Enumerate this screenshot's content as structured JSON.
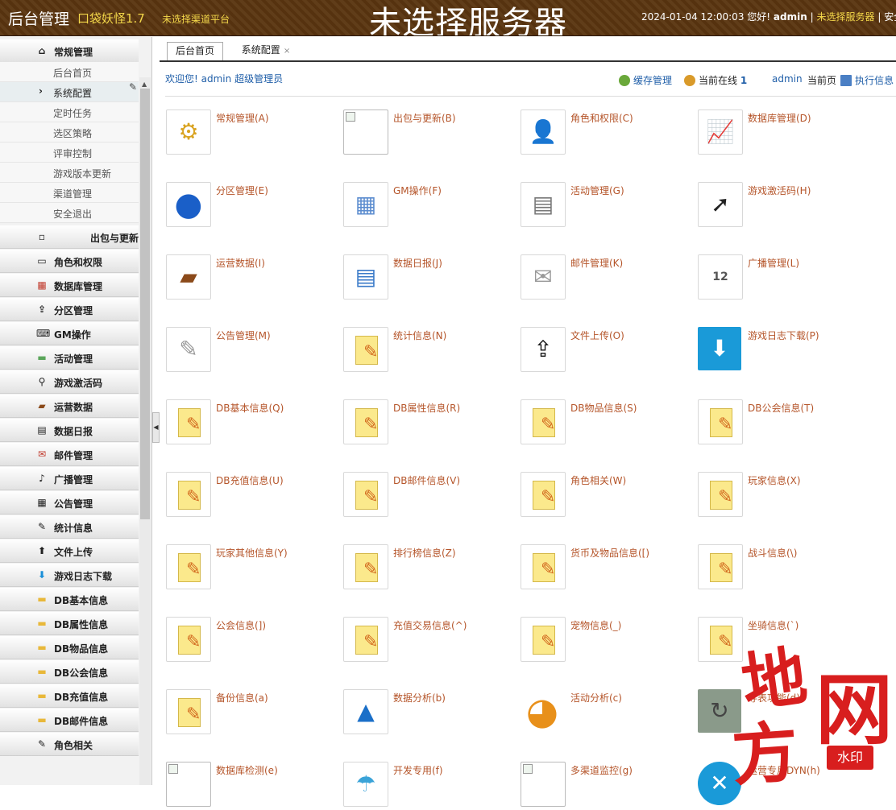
{
  "header": {
    "title": "后台管理",
    "game": "口袋妖怪1.7",
    "channel": "未选择渠道平台",
    "server_big": "未选择服务器",
    "datetime": "2024-01-04 12:00:03",
    "greeting": "您好!",
    "user": "admin",
    "sep1": "|",
    "server_link": "未选择服务器",
    "sep2": "|",
    "exit": "安全退"
  },
  "sidebar": {
    "sections": [
      {
        "label": "常规管理",
        "icon": "home-icon"
      },
      {
        "label": "出包与更新",
        "icon": "broken-image-icon"
      },
      {
        "label": "角色和权限",
        "icon": "monitor-icon"
      },
      {
        "label": "数据库管理",
        "icon": "database-icon"
      },
      {
        "label": "分区管理",
        "icon": "upload-icon"
      },
      {
        "label": "GM操作",
        "icon": "keyboard-icon"
      },
      {
        "label": "活动管理",
        "icon": "money-icon"
      },
      {
        "label": "游戏激活码",
        "icon": "search-icon"
      },
      {
        "label": "运营数据",
        "icon": "wallet-icon"
      },
      {
        "label": "数据日报",
        "icon": "report-icon"
      },
      {
        "label": "邮件管理",
        "icon": "mail-icon"
      },
      {
        "label": "广播管理",
        "icon": "speaker-icon"
      },
      {
        "label": "公告管理",
        "icon": "calendar-icon"
      },
      {
        "label": "统计信息",
        "icon": "edit-icon"
      },
      {
        "label": "文件上传",
        "icon": "upload-arrow-icon"
      },
      {
        "label": "游戏日志下载",
        "icon": "download-icon"
      },
      {
        "label": "DB基本信息",
        "icon": "folder-icon"
      },
      {
        "label": "DB属性信息",
        "icon": "folder-icon"
      },
      {
        "label": "DB物品信息",
        "icon": "folder-icon"
      },
      {
        "label": "DB公会信息",
        "icon": "folder-icon"
      },
      {
        "label": "DB充值信息",
        "icon": "folder-icon"
      },
      {
        "label": "DB邮件信息",
        "icon": "folder-icon"
      },
      {
        "label": "角色相关",
        "icon": "pencil-icon"
      }
    ],
    "sub_items": [
      "后台首页",
      "系统配置",
      "定时任务",
      "选区策略",
      "评审控制",
      "游戏版本更新",
      "渠道管理",
      "安全退出"
    ],
    "active_sub": "系统配置"
  },
  "tabs": [
    {
      "label": "后台首页",
      "active": true
    },
    {
      "label": "系统配置",
      "active": false,
      "close": "×"
    }
  ],
  "welcome": {
    "text": "欢迎您!",
    "user": "admin",
    "role": "超级管理员"
  },
  "toolbar": {
    "cache": "缓存管理",
    "online": "当前在线",
    "online_count": "1",
    "user": "admin",
    "current_page": "当前页",
    "exec": "执行信息"
  },
  "grid": [
    {
      "label": "常规管理(A)",
      "icon": "gear-icon"
    },
    {
      "label": "出包与更新(B)",
      "icon": "broken-image-icon"
    },
    {
      "label": "角色和权限(C)",
      "icon": "user-icon"
    },
    {
      "label": "数据库管理(D)",
      "icon": "chart-doc-icon"
    },
    {
      "label": "分区管理(E)",
      "icon": "globe-icon"
    },
    {
      "label": "GM操作(F)",
      "icon": "table-icon"
    },
    {
      "label": "活动管理(G)",
      "icon": "news-icon"
    },
    {
      "label": "游戏激活码(H)",
      "icon": "cursor-icon"
    },
    {
      "label": "运营数据(I)",
      "icon": "wallet-icon"
    },
    {
      "label": "数据日报(J)",
      "icon": "report-icon"
    },
    {
      "label": "邮件管理(K)",
      "icon": "envelope-icon"
    },
    {
      "label": "广播管理(L)",
      "icon": "calendar-icon"
    },
    {
      "label": "公告管理(M)",
      "icon": "comment-icon"
    },
    {
      "label": "统计信息(N)",
      "icon": "note-icon"
    },
    {
      "label": "文件上传(O)",
      "icon": "upload-icon"
    },
    {
      "label": "游戏日志下载(P)",
      "icon": "download-icon"
    },
    {
      "label": "DB基本信息(Q)",
      "icon": "note-icon"
    },
    {
      "label": "DB属性信息(R)",
      "icon": "note-icon"
    },
    {
      "label": "DB物品信息(S)",
      "icon": "note-icon"
    },
    {
      "label": "DB公会信息(T)",
      "icon": "note-icon"
    },
    {
      "label": "DB充值信息(U)",
      "icon": "note-icon"
    },
    {
      "label": "DB邮件信息(V)",
      "icon": "note-icon"
    },
    {
      "label": "角色相关(W)",
      "icon": "note-icon"
    },
    {
      "label": "玩家信息(X)",
      "icon": "note-icon"
    },
    {
      "label": "玩家其他信息(Y)",
      "icon": "note-icon"
    },
    {
      "label": "排行榜信息(Z)",
      "icon": "note-icon"
    },
    {
      "label": "货币及物品信息([)",
      "icon": "note-icon"
    },
    {
      "label": "战斗信息(\\)",
      "icon": "note-icon"
    },
    {
      "label": "公会信息(])",
      "icon": "note-icon"
    },
    {
      "label": "充值交易信息(^)",
      "icon": "note-icon"
    },
    {
      "label": "宠物信息(_)",
      "icon": "note-icon"
    },
    {
      "label": "坐骑信息(`)",
      "icon": "note-icon"
    },
    {
      "label": "备份信息(a)",
      "icon": "note-icon"
    },
    {
      "label": "数据分析(b)",
      "icon": "growth-icon"
    },
    {
      "label": "活动分析(c)",
      "icon": "pie-icon"
    },
    {
      "label": "导表功能(d)",
      "icon": "share-arrow-icon"
    },
    {
      "label": "数据库检测(e)",
      "icon": "broken-image-icon"
    },
    {
      "label": "开发专用(f)",
      "icon": "umbrella-icon"
    },
    {
      "label": "多渠道监控(g)",
      "icon": "broken-image-icon"
    },
    {
      "label": "运营专用DYN(h)",
      "icon": "tools-icon"
    }
  ],
  "watermark": {
    "chars": [
      "地",
      "网",
      "方"
    ],
    "stamp": "水印"
  },
  "colors": {
    "header_bg": "#5a3510",
    "accent_yellow": "#f4d84a",
    "link_blue": "#1f5ea8",
    "grid_label": "#b5552a",
    "watermark_red": "#d81e1e"
  }
}
